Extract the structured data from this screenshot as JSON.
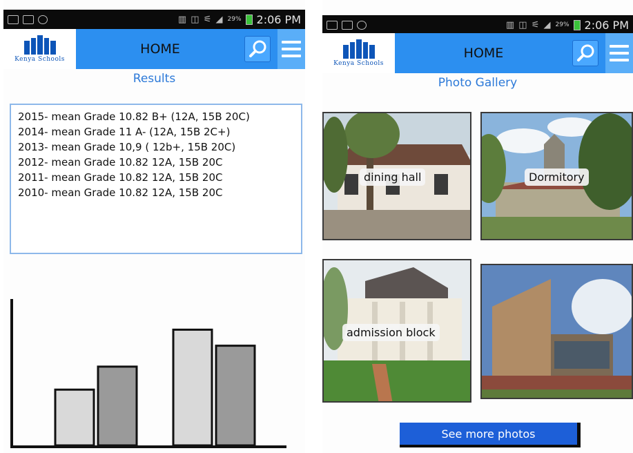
{
  "status_bar": {
    "time": "2:06 PM",
    "battery": "29%"
  },
  "header": {
    "logo_text": "Kenya Schools",
    "title": "HOME"
  },
  "results": {
    "title": "Results",
    "lines": [
      "2015- mean Grade 10.82 B+ (12A, 15B 20C)",
      "2014- mean Grade 11 A- (12A, 15B 2C+)",
      "2013- mean Grade 10,9 ( 12b+, 15B 20C)",
      "2012- mean Grade 10.82 12A, 15B 20C",
      "2011- mean Grade 10.82 12A, 15B 20C",
      "2010- mean Grade 10.82 12A, 15B 20C"
    ]
  },
  "chart_data": {
    "type": "bar",
    "values": [
      80,
      113,
      166,
      143
    ],
    "colors": [
      "#d9d9d9",
      "#9a9a9a",
      "#d9d9d9",
      "#9a9a9a"
    ],
    "ylim": [
      0,
      210
    ]
  },
  "gallery": {
    "title": "Photo Gallery",
    "items": [
      {
        "label": "dining hall"
      },
      {
        "label": "Dormitory"
      },
      {
        "label": "admission block"
      },
      {
        "label": ""
      }
    ],
    "see_more_label": "See more photos"
  }
}
